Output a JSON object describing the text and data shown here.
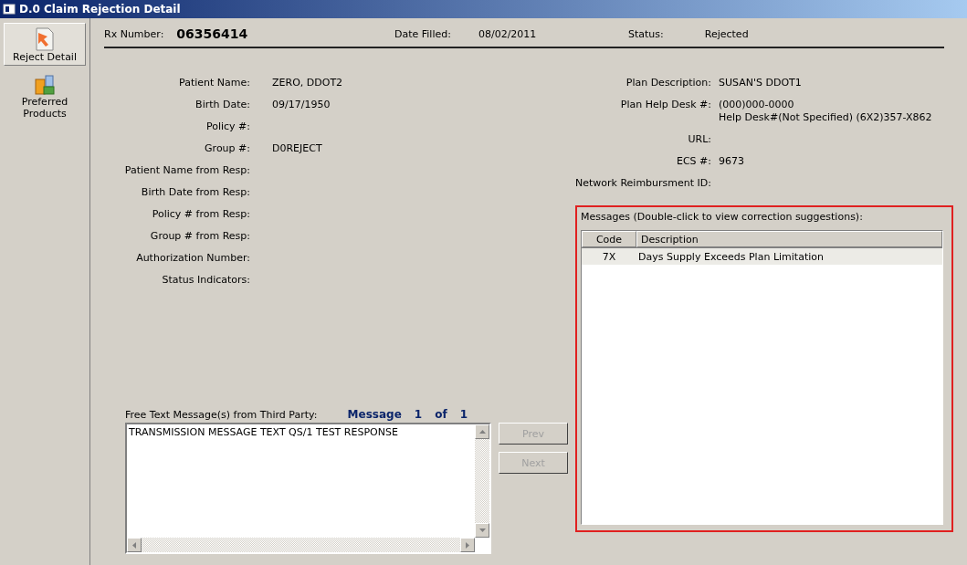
{
  "window": {
    "title": "D.0 Claim Rejection Detail"
  },
  "sidebar": {
    "items": [
      {
        "label": "Reject Detail",
        "selected": true,
        "kind": "document"
      },
      {
        "label": "Preferred Products",
        "selected": false,
        "kind": "products"
      }
    ]
  },
  "header": [
    {
      "label": "Rx Number:",
      "value": "06356414",
      "kind": "big"
    },
    {
      "label": "Date Filled:",
      "value": "08/02/2011",
      "kind": "normal"
    },
    {
      "label": "Status:",
      "value": "Rejected",
      "kind": "normal"
    }
  ],
  "patient_fields": [
    {
      "label": "Patient Name:",
      "value": "ZERO, DDOT2"
    },
    {
      "label": "Birth Date:",
      "value": "09/17/1950"
    },
    {
      "label": "Policy #:"
    },
    {
      "label": "Group #:",
      "value": "D0REJECT"
    },
    {
      "label": "Patient Name from Resp:"
    },
    {
      "label": "Birth Date from Resp:"
    },
    {
      "label": "Policy # from Resp:"
    },
    {
      "label": "Group # from Resp:"
    },
    {
      "label": "Authorization Number:"
    },
    {
      "label": "Status Indicators:"
    }
  ],
  "plan_fields": [
    {
      "label": "Plan Description:",
      "value": "SUSAN'S DDOT1"
    },
    {
      "label": "Plan Help Desk #:",
      "value": "(000)000-0000",
      "note": "Help Desk#(Not Specified) (6X2)357-X862"
    },
    {
      "label": "URL:"
    },
    {
      "label": "ECS #:",
      "value": "9673"
    },
    {
      "label": "Network Reimbursment ID:"
    }
  ],
  "messages": {
    "title": "Messages (Double-click to view correction suggestions):",
    "columns": [
      "Code",
      "Description"
    ],
    "rows": [
      {
        "code": "7X",
        "description": "Days Supply Exceeds Plan Limitation",
        "selected": true
      }
    ]
  },
  "free_text": {
    "label": "Free Text Message(s) from Third Party:",
    "counter": [
      "Message",
      "1",
      "of",
      "1"
    ],
    "value": "TRANSMISSION MESSAGE TEXT QS/1 TEST RESPONSE"
  },
  "buttons": [
    {
      "label": "Prev",
      "disabled": true
    },
    {
      "label": "Next",
      "disabled": true
    }
  ]
}
